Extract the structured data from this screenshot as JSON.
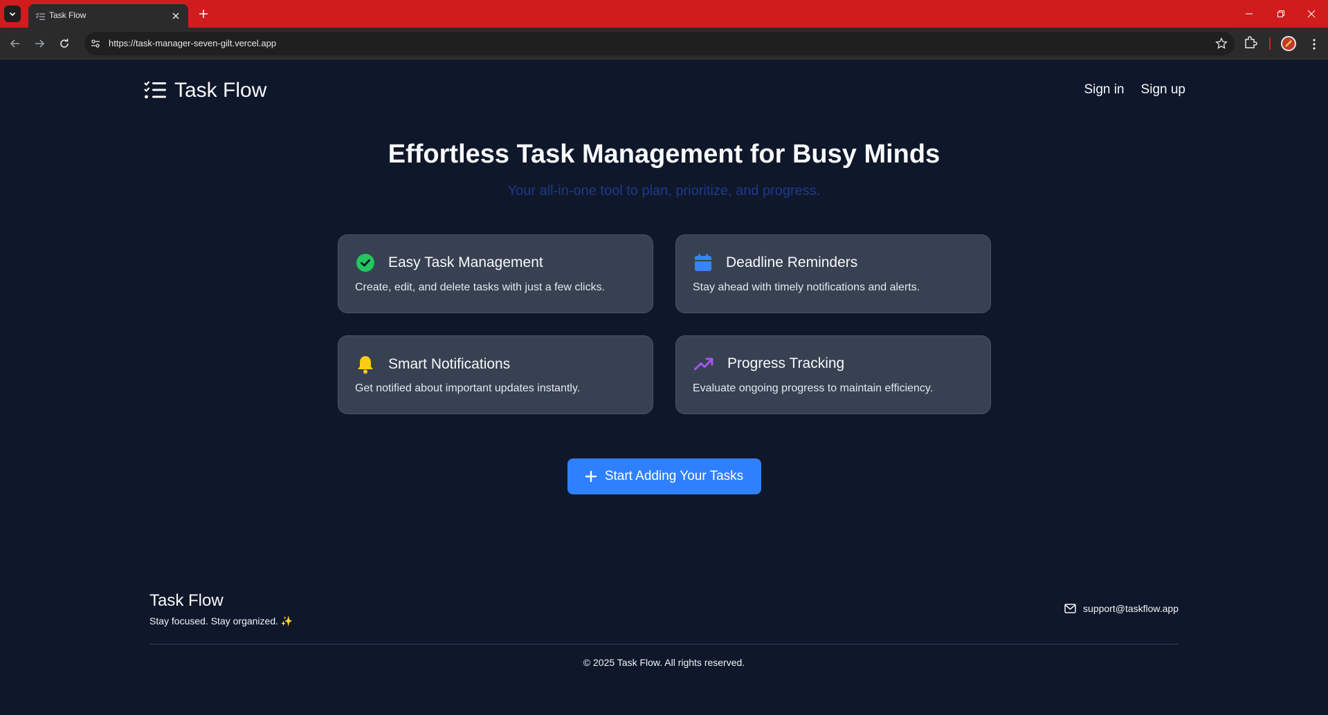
{
  "browser": {
    "tab_title": "Task Flow",
    "url": "https://task-manager-seven-gilt.vercel.app",
    "accent_color": "#d01c1c"
  },
  "header": {
    "logo_text": "Task Flow",
    "logo_icon": "list-check-icon",
    "nav": {
      "sign_in": "Sign in",
      "sign_up": "Sign up"
    }
  },
  "hero": {
    "title": "Effortless Task Management for Busy Minds",
    "subtitle": "Your all-in-one tool to plan, prioritize, and progress."
  },
  "features": [
    {
      "icon": "check-circle-icon",
      "icon_color": "#22c55e",
      "title": "Easy Task Management",
      "description": "Create, edit, and delete tasks with just a few clicks."
    },
    {
      "icon": "calendar-icon",
      "icon_color": "#3b82f6",
      "title": "Deadline Reminders",
      "description": "Stay ahead with timely notifications and alerts."
    },
    {
      "icon": "bell-icon",
      "icon_color": "#facc15",
      "title": "Smart Notifications",
      "description": "Get notified about important updates instantly."
    },
    {
      "icon": "trending-up-icon",
      "icon_color": "#a855f7",
      "title": "Progress Tracking",
      "description": "Evaluate ongoing progress to maintain efficiency."
    }
  ],
  "cta": {
    "label": "Start Adding Your Tasks",
    "icon": "plus-icon",
    "color": "#2f80ff"
  },
  "footer": {
    "brand": "Task Flow",
    "tagline": "Stay focused. Stay organized. ✨",
    "email": "support@taskflow.app",
    "copyright": "© 2025 Task Flow. All rights reserved."
  }
}
